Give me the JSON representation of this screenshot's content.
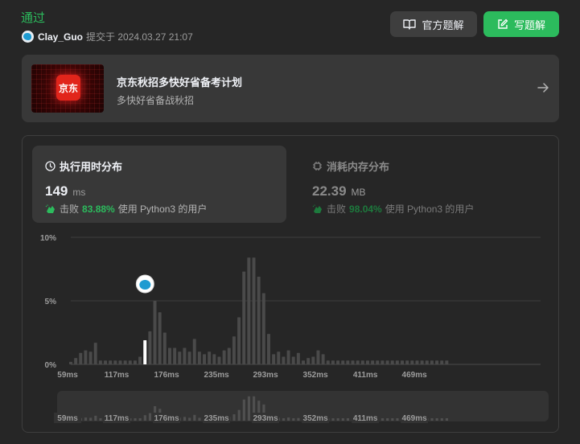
{
  "status": "通过",
  "author": {
    "name": "Clay_Guo",
    "submitted_text": "提交于 2024.03.27 21:07"
  },
  "buttons": {
    "official_solution": "官方题解",
    "write_solution": "写题解"
  },
  "banner": {
    "logo_text": "京东",
    "title": "京东秋招多快好省备考计划",
    "subtitle": "多快好省备战秋招"
  },
  "runtime": {
    "label": "执行用时分布",
    "value": "149",
    "unit": "ms",
    "beats_label": "击败",
    "beats": "83.88%",
    "beats_suffix": "使用 Python3 的用户"
  },
  "memory": {
    "label": "消耗内存分布",
    "value": "22.39",
    "unit": "MB",
    "beats_label": "击败",
    "beats": "98.04%",
    "beats_suffix": "使用 Python3 的用户"
  },
  "colors": {
    "accent": "#2cbb5d",
    "bar": "#4a4a4a",
    "bar_selected": "#ffffff"
  },
  "chart_data": {
    "type": "bar",
    "y_tick_labels": [
      "10%",
      "5%",
      "0%"
    ],
    "ylim": [
      0,
      10
    ],
    "grid": true,
    "x_tick_labels": [
      "59ms",
      "117ms",
      "176ms",
      "235ms",
      "293ms",
      "352ms",
      "411ms",
      "469ms"
    ],
    "x_tick_values": [
      59,
      117,
      176,
      235,
      293,
      352,
      411,
      469
    ],
    "bin_width_ms": 5.85,
    "x_start_ms": 59,
    "selected_value_ms": 149,
    "values": [
      0.2,
      0.5,
      0.9,
      1.1,
      1.0,
      1.7,
      0.3,
      0.3,
      0.3,
      0.3,
      0.3,
      0.3,
      0.3,
      0.3,
      0.6,
      1.9,
      2.6,
      5.0,
      4.1,
      2.5,
      1.3,
      1.3,
      1.0,
      1.3,
      1.0,
      2.0,
      1.0,
      0.8,
      1.0,
      0.8,
      0.6,
      1.1,
      1.3,
      2.2,
      3.7,
      7.3,
      8.4,
      8.4,
      6.9,
      5.6,
      2.4,
      0.8,
      1.0,
      0.6,
      1.1,
      0.6,
      0.9,
      0.3,
      0.5,
      0.6,
      1.1,
      0.8,
      0.3,
      0.3,
      0.3,
      0.3,
      0.3,
      0.3,
      0.3,
      0.3,
      0.3,
      0.3,
      0.3,
      0.3,
      0.3,
      0.3,
      0.3,
      0.3,
      0.3,
      0.3,
      0.3,
      0.3,
      0.3,
      0.3,
      0.3,
      0.3,
      0.3
    ]
  }
}
